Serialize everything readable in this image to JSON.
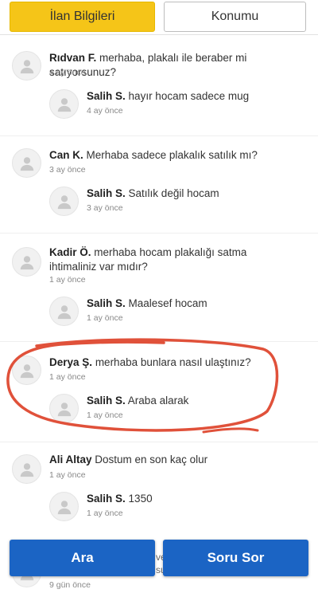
{
  "tabs": {
    "info": "İlan Bilgileri",
    "location": "Konumu"
  },
  "threads": [
    {
      "question": {
        "author": "Rıdvan F.",
        "text": "merhaba, plakalı ile beraber mi satıyorsunuz?",
        "time": "4 ay önce"
      },
      "answer": {
        "author": "Salih S.",
        "text": "hayır hocam sadece mug",
        "time": "4 ay önce"
      }
    },
    {
      "question": {
        "author": "Can K.",
        "text": "Merhaba sadece plakalık satılık mı?",
        "time": "3 ay önce"
      },
      "answer": {
        "author": "Salih S.",
        "text": "Satılık değil hocam",
        "time": "3 ay önce"
      }
    },
    {
      "question": {
        "author": "Kadir Ö.",
        "text": "merhaba hocam plakalığı satma ihtimaliniz var mıdır?",
        "time": "1 ay önce"
      },
      "answer": {
        "author": "Salih S.",
        "text": "Maalesef hocam",
        "time": "1 ay önce"
      }
    },
    {
      "question": {
        "author": "Derya Ş.",
        "text": "merhaba bunlara nasıl ulaştınız?",
        "time": "1 ay önce"
      },
      "answer": {
        "author": "Salih S.",
        "text": "Araba alarak",
        "time": "1 ay önce"
      }
    },
    {
      "question": {
        "author": "Ali Altay",
        "text": "Dostum en son kaç olur",
        "time": "1 ay önce"
      },
      "answer": {
        "author": "Salih S.",
        "text": "1350",
        "time": "1 ay önce"
      }
    }
  ],
  "peek": {
    "time": "9 gün önce",
    "text_fragment": "ve",
    "text_fragment2": "su"
  },
  "actions": {
    "call": "Ara",
    "ask": "Soru Sor"
  },
  "colors": {
    "accent_tab": "#f5c518",
    "button": "#1b64c4",
    "highlight_circle": "#e0513a"
  }
}
